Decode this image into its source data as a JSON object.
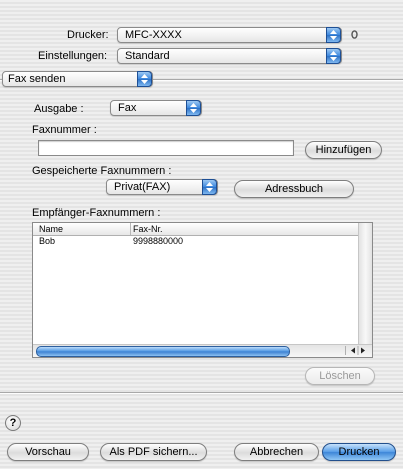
{
  "printer": {
    "label": "Drucker:",
    "value": "MFC-XXXX"
  },
  "settings": {
    "label": "Einstellungen:",
    "value": "Standard"
  },
  "panel_menu": {
    "value": "Fax senden"
  },
  "output": {
    "label": "Ausgabe :",
    "value": "Fax"
  },
  "fax_number": {
    "label": "Faxnummer :",
    "value": "",
    "add_button": "Hinzufügen"
  },
  "saved": {
    "label": "Gespeicherte Faxnummern :",
    "value": "Privat(FAX)",
    "address_book_button": "Adressbuch"
  },
  "recipients": {
    "label": "Empfänger-Faxnummern :",
    "columns": [
      "Name",
      "Fax-Nr."
    ],
    "rows": [
      {
        "name": "Bob",
        "fax": "9998880000"
      }
    ],
    "delete_button": "Löschen"
  },
  "footer": {
    "help": "?",
    "preview": "Vorschau",
    "save_pdf": "Als PDF sichern...",
    "cancel": "Abbrechen",
    "print": "Drucken"
  }
}
